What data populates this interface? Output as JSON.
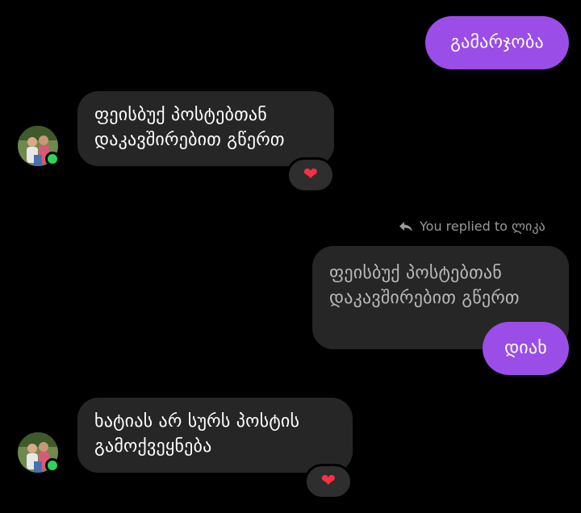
{
  "messages": {
    "m1": {
      "text": "გამარჯობა"
    },
    "m2": {
      "line1": "ფეისბუქ პოსტებთან",
      "line2": "დაკავშირებით გწერთ",
      "reaction": "❤"
    },
    "reply_note": {
      "text": "You replied to ლიკა",
      "icon": "reply-arrow-icon"
    },
    "m3_quote": {
      "line1": "ფეისბუქ პოსტებთან",
      "line2": "დაკავშირებით გწერთ"
    },
    "m3": {
      "text": "დიახ"
    },
    "m4": {
      "line1": "ხატიას არ სურს პოსტის",
      "line2": "გამოქვეყნება",
      "reaction": "❤"
    }
  },
  "colors": {
    "background": "#000000",
    "outgoing_bubble": "#9b4de8",
    "incoming_bubble": "#262626",
    "online": "#2fd35a",
    "heart": "#ff2d45"
  }
}
